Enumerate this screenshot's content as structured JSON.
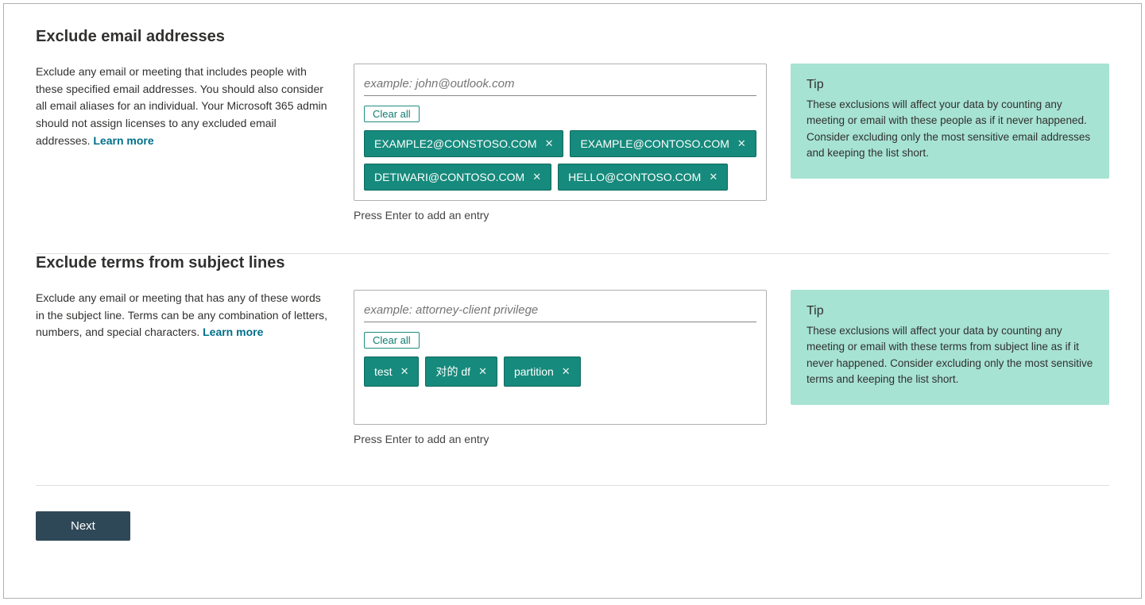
{
  "section1": {
    "title": "Exclude email addresses",
    "description": "Exclude any email or meeting that includes people with these specified email addresses. You should also consider all email aliases for an individual. Your Microsoft 365 admin should not assign licenses to any excluded email addresses. ",
    "learn_more": "Learn more",
    "input_placeholder": "example: john@outlook.com",
    "clear_all": "Clear all",
    "tags": [
      "EXAMPLE2@CONSTOSO.COM",
      "EXAMPLE@CONTOSO.COM",
      "DETIWARI@CONTOSO.COM",
      "HELLO@CONTOSO.COM"
    ],
    "hint": "Press Enter to add an entry",
    "tip_title": "Tip",
    "tip_body": "These exclusions will affect your data by counting any meeting or email with these people as if it never happened. Consider excluding only the most sensitive email addresses and keeping the list short."
  },
  "section2": {
    "title": "Exclude terms from subject lines",
    "description": "Exclude any email or meeting that has any of these words in the subject line. Terms can be any combination of letters, numbers, and special characters. ",
    "learn_more": "Learn more",
    "input_placeholder": "example: attorney-client privilege",
    "clear_all": "Clear all",
    "tags": [
      "test",
      "对的 df",
      "partition"
    ],
    "hint": "Press Enter to add an entry",
    "tip_title": "Tip",
    "tip_body": "These exclusions will affect your data by counting any meeting or email with these terms from subject line as if it never happened. Consider excluding only the most sensitive terms and keeping the list short."
  },
  "footer": {
    "next": "Next"
  }
}
